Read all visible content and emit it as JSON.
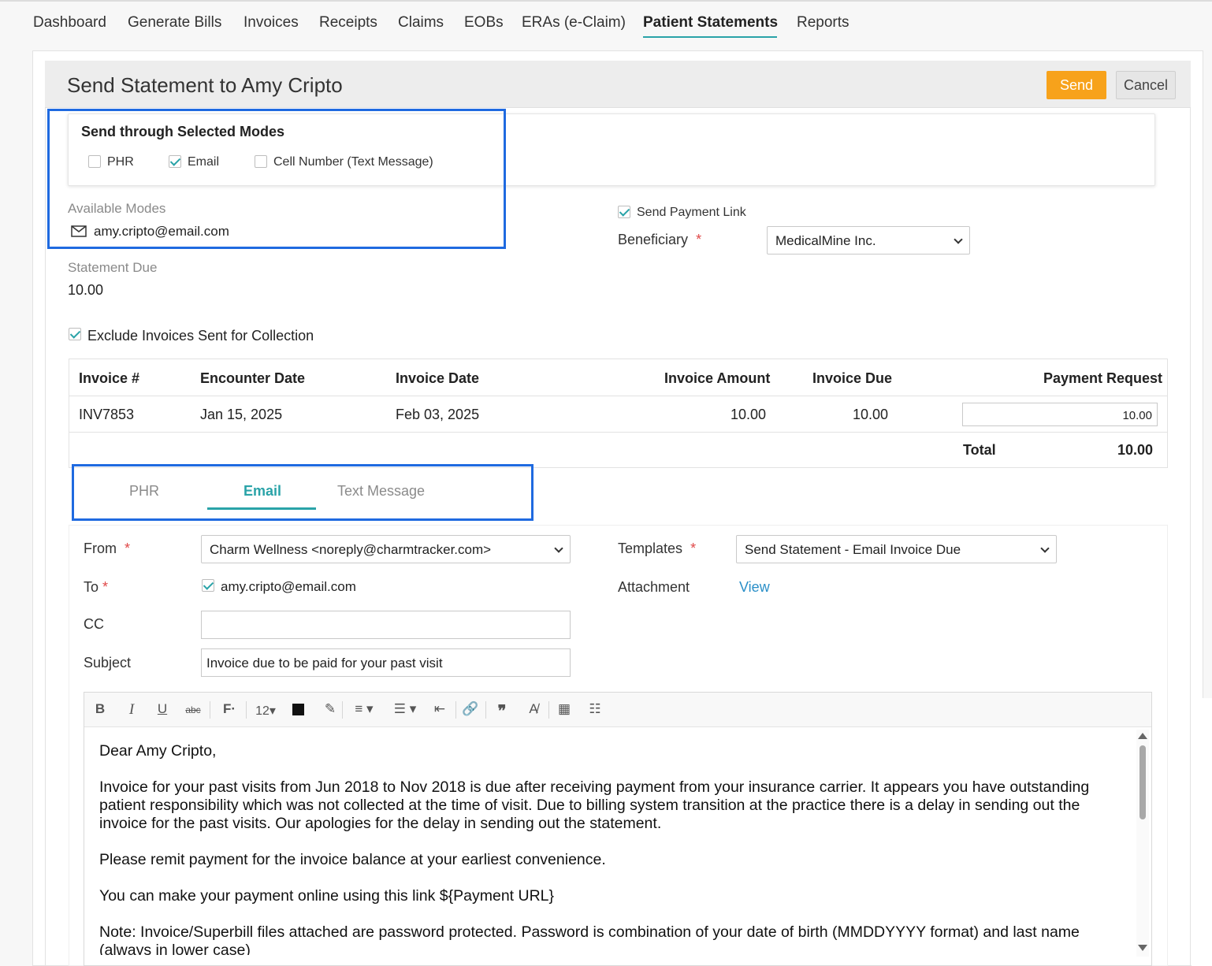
{
  "nav": {
    "items": [
      "Dashboard",
      "Generate Bills",
      "Invoices",
      "Receipts",
      "Claims",
      "EOBs",
      "ERAs (e-Claim)",
      "Patient Statements",
      "Reports"
    ],
    "active": "Patient Statements"
  },
  "header": {
    "title": "Send Statement to Amy Cripto",
    "send_label": "Send",
    "cancel_label": "Cancel"
  },
  "modes": {
    "heading": "Send through Selected Modes",
    "options": [
      {
        "label": "PHR",
        "checked": false
      },
      {
        "label": "Email",
        "checked": true
      },
      {
        "label": "Cell Number (Text Message)",
        "checked": false
      }
    ],
    "available_label": "Available Modes",
    "available_email": "amy.cripto@email.com"
  },
  "statement": {
    "due_label": "Statement Due",
    "due_value": "10.00",
    "exclude_label": "Exclude Invoices Sent for Collection",
    "exclude_checked": true
  },
  "payment": {
    "send_link_label": "Send Payment Link",
    "send_link_checked": true,
    "beneficiary_label": "Beneficiary",
    "beneficiary_value": "MedicalMine Inc."
  },
  "table": {
    "headers": [
      "Invoice #",
      "Encounter Date",
      "Invoice Date",
      "Invoice Amount",
      "Invoice Due",
      "Payment Request"
    ],
    "rows": [
      {
        "invoice": "INV7853",
        "encounter_date": "Jan 15, 2025",
        "invoice_date": "Feb 03, 2025",
        "amount": "10.00",
        "due": "10.00",
        "request": "10.00"
      }
    ],
    "total_label": "Total",
    "total_value": "10.00"
  },
  "tabs": {
    "items": [
      "PHR",
      "Email",
      "Text Message"
    ],
    "active": "Email"
  },
  "email": {
    "from_label": "From",
    "from_value": "Charm Wellness <noreply@charmtracker.com>",
    "to_label": "To",
    "to_value": "amy.cripto@email.com",
    "cc_label": "CC",
    "cc_value": "",
    "subject_label": "Subject",
    "subject_value": "Invoice due to be paid for your past visit",
    "templates_label": "Templates",
    "templates_value": "Send Statement - Email Invoice Due",
    "attachment_label": "Attachment",
    "attachment_link": "View"
  },
  "toolbar": {
    "font_size": "12"
  },
  "body": {
    "greeting": "Dear Amy Cripto,",
    "p1": "Invoice for your past visits from Jun 2018 to Nov 2018 is due after receiving payment from your insurance carrier. It appears you have outstanding patient responsibility which was not collected at the time of visit. Due to billing system transition at the practice there is a delay in sending out the invoice for the past visits. Our apologies for the delay in sending out the statement.",
    "p2": "Please remit payment for the invoice balance at your earliest convenience.",
    "p3": "You can make your payment online using this link ${Payment URL}",
    "p4": "Note: Invoice/Superbill files attached are password protected. Password is combination of your date of birth (MMDDYYYY format) and last name (always in lower case)"
  },
  "colors": {
    "accent": "#2aa3a8",
    "send_button": "#f7a21b",
    "highlight_box": "#1f6ae0",
    "link": "#2a8fc8"
  }
}
